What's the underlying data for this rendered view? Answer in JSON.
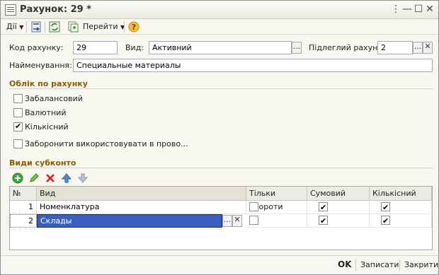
{
  "window": {
    "title": "Рахунок: 29 *"
  },
  "toolbar": {
    "actions_label": "Дії",
    "goto_label": "Перейти"
  },
  "form": {
    "code_label": "Код рахунку:",
    "code_value": "29",
    "type_label": "Вид:",
    "type_value": "Активний",
    "parent_label": "Підлеглий рахун...",
    "parent_value": "2",
    "name_label": "Найменування:",
    "name_value": "Специальные материалы"
  },
  "accounting": {
    "title": "Облік по рахунку",
    "off_balance_label": "Забалансовий",
    "currency_label": "Валютний",
    "quantity_label": "Кількісний",
    "forbid_label": "Заборонити використовувати в прово..."
  },
  "subconto": {
    "title": "Види субконто",
    "columns": [
      "№",
      "Вид",
      "Тільки обороти",
      "Сумовий",
      "Кількісний"
    ],
    "rows": [
      {
        "num": "1",
        "kind": "Номенклатура"
      },
      {
        "num": "2",
        "kind": "Склады"
      }
    ]
  },
  "footer": {
    "ok_label": "OK",
    "save_label": "Записати",
    "close_label": "Закрити"
  },
  "colors": {
    "section_title": "#8b5a00",
    "selection": "#3b5fbf"
  }
}
